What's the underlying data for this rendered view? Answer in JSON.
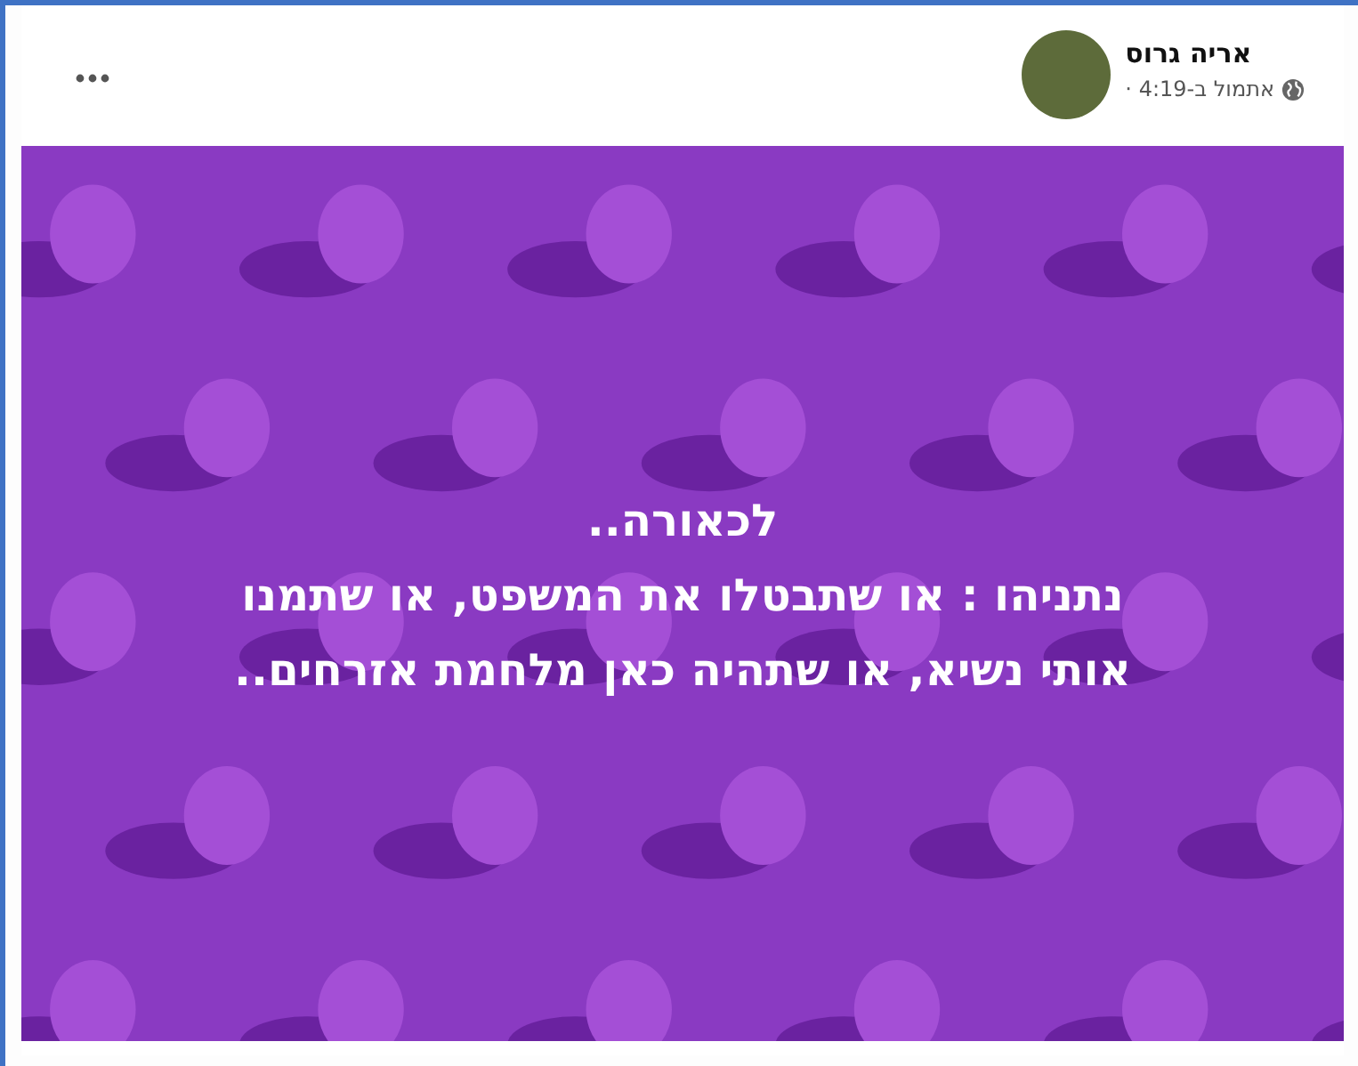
{
  "post": {
    "author": "אריה גרוס",
    "timestamp": "אתמול ב-4:19 ·",
    "text_lines": [
      "לכאורה..",
      "נתניהו : או שתבטלו את המשפט, או שתמנו",
      "אותי נשיא, או שתהיה כאן מלחמת אזרחים.."
    ]
  }
}
